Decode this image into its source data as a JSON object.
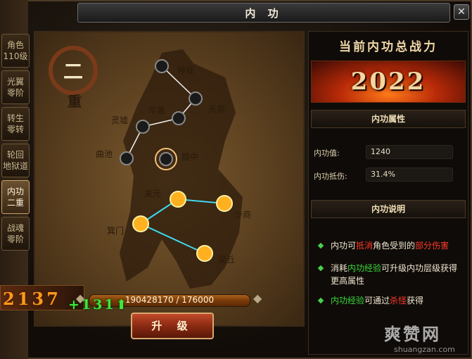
{
  "window": {
    "title": "内 功",
    "close_label": "✕"
  },
  "tabs": [
    {
      "label": "角色\n110级",
      "active": false
    },
    {
      "label": "光翼\n零阶",
      "active": false
    },
    {
      "label": "转生\n零转",
      "active": false
    },
    {
      "label": "轮回\n地狱道",
      "active": false
    },
    {
      "label": "内功\n二重",
      "active": true
    },
    {
      "label": "战魂\n零阶",
      "active": false
    }
  ],
  "tier": {
    "number": "二",
    "unit": "重"
  },
  "meridian_nodes": [
    {
      "name": "神庭",
      "lit": false
    },
    {
      "name": "天鼎",
      "lit": false
    },
    {
      "name": "华盖",
      "lit": false
    },
    {
      "name": "灵墟",
      "lit": false
    },
    {
      "name": "曲池",
      "lit": false
    },
    {
      "name": "膻中",
      "lit": false,
      "selected": true
    },
    {
      "name": "关元",
      "lit": true
    },
    {
      "name": "少商",
      "lit": true
    },
    {
      "name": "箕门",
      "lit": true
    },
    {
      "name": "梁丘",
      "lit": true
    }
  ],
  "power": {
    "title": "当前内功总战力",
    "value": "2022"
  },
  "attributes": {
    "header": "内功属性",
    "items": [
      {
        "label": "内功值:",
        "value": "1240"
      },
      {
        "label": "内功抵伤:",
        "value": "31.4%"
      }
    ]
  },
  "description": {
    "header": "内功说明",
    "line1": {
      "a": "内功可",
      "b": "抵消",
      "c": "角色受到的",
      "d": "部分伤害"
    },
    "line2": {
      "a": "消耗",
      "b": "内功经验",
      "c": "可升级内功层级获得更高属性"
    },
    "line3": {
      "a": "内功经验",
      "b": "可通过",
      "c": "杀怪",
      "d": "获得"
    }
  },
  "experience": {
    "text": "190428170 / 176000",
    "current": 190428170,
    "required": 176000
  },
  "bottom": {
    "current_value": "2137",
    "gain": "+131",
    "gain_arrow": "⬆"
  },
  "upgrade_button": "升 级",
  "watermark": {
    "cn": "爽赞网",
    "en": "shuangzan.com"
  },
  "colors": {
    "accent_gold": "#c9a46a",
    "fire": "#ff7a1a",
    "highlight_red": "#ff3a2a",
    "highlight_green": "#3ad83a"
  }
}
